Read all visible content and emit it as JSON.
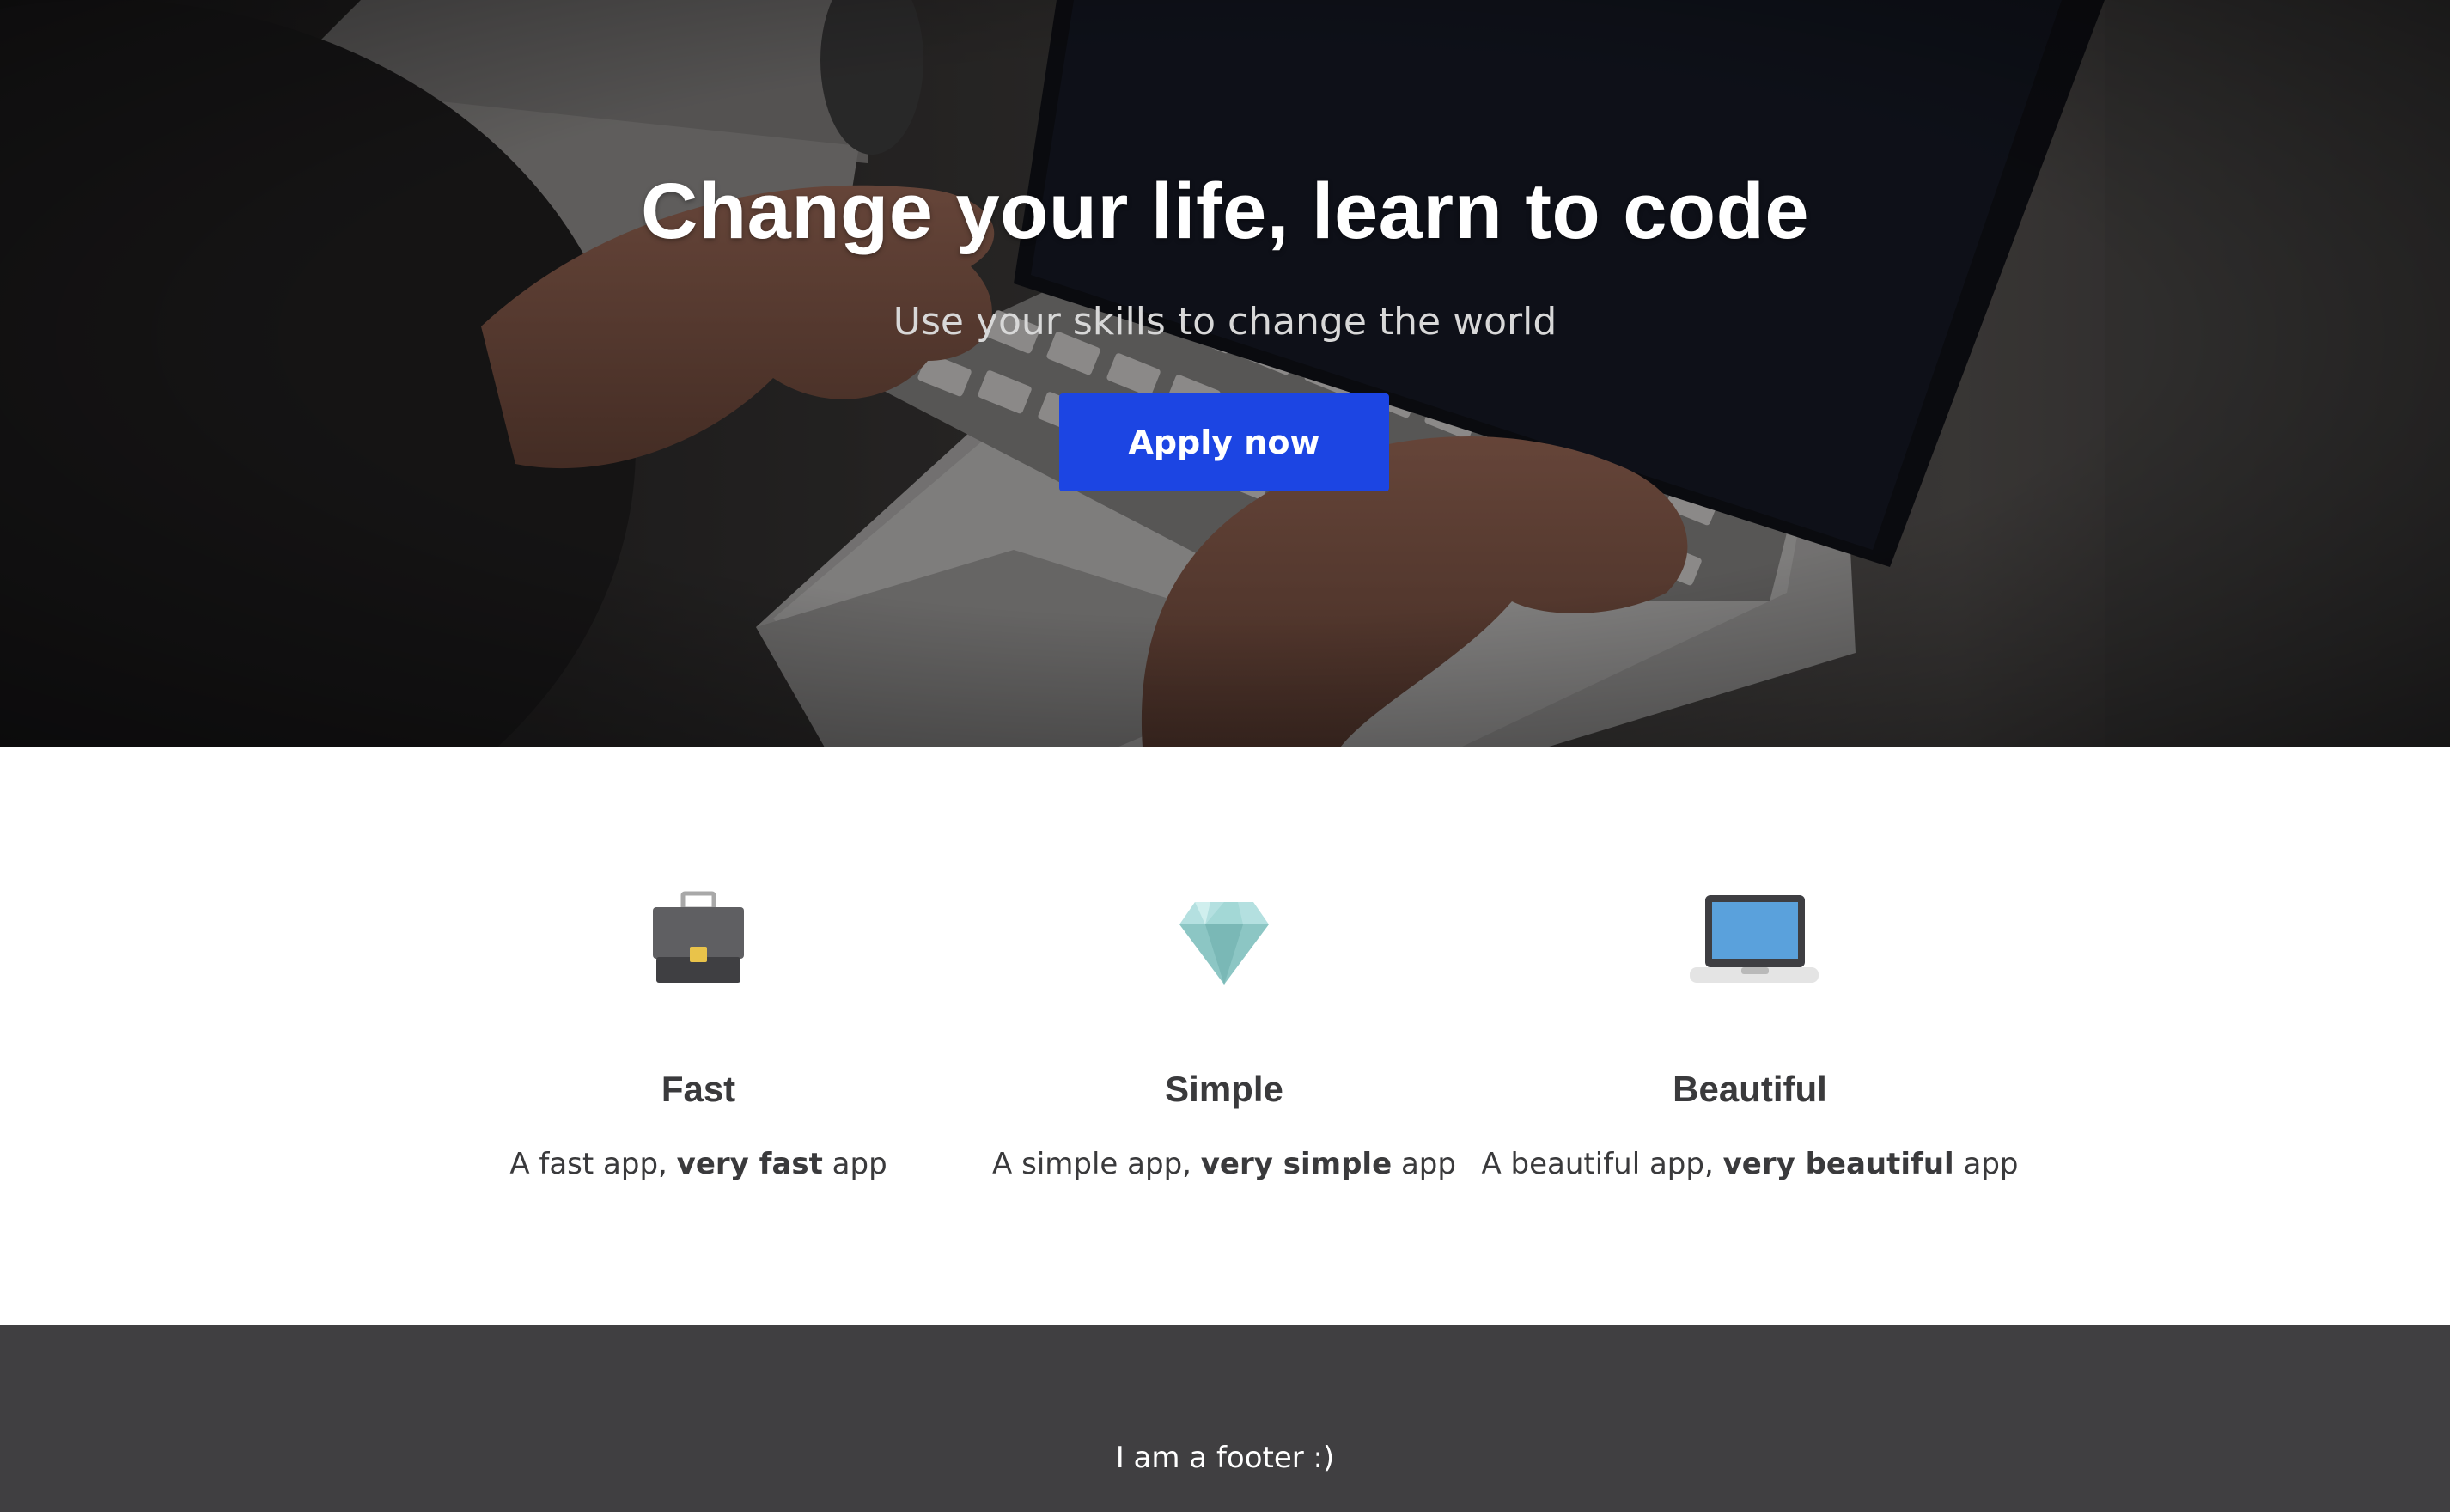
{
  "hero": {
    "title": "Change your life, learn to code",
    "subtitle": "Use your skills to change the world",
    "button_label": "Apply now",
    "button_color": "#1c45e3"
  },
  "features": [
    {
      "icon": "briefcase-icon",
      "title": "Fast",
      "desc_prefix": "A fast app, ",
      "desc_bold": "very fast",
      "desc_suffix": " app"
    },
    {
      "icon": "diamond-icon",
      "title": "Simple",
      "desc_prefix": "A simple app, ",
      "desc_bold": "very simple",
      "desc_suffix": " app"
    },
    {
      "icon": "laptop-icon",
      "title": "Beautiful",
      "desc_prefix": "A beautiful app, ",
      "desc_bold": "very beautiful",
      "desc_suffix": " app"
    }
  ],
  "footer": {
    "text": "I am a footer :)",
    "background": "#403f41"
  }
}
